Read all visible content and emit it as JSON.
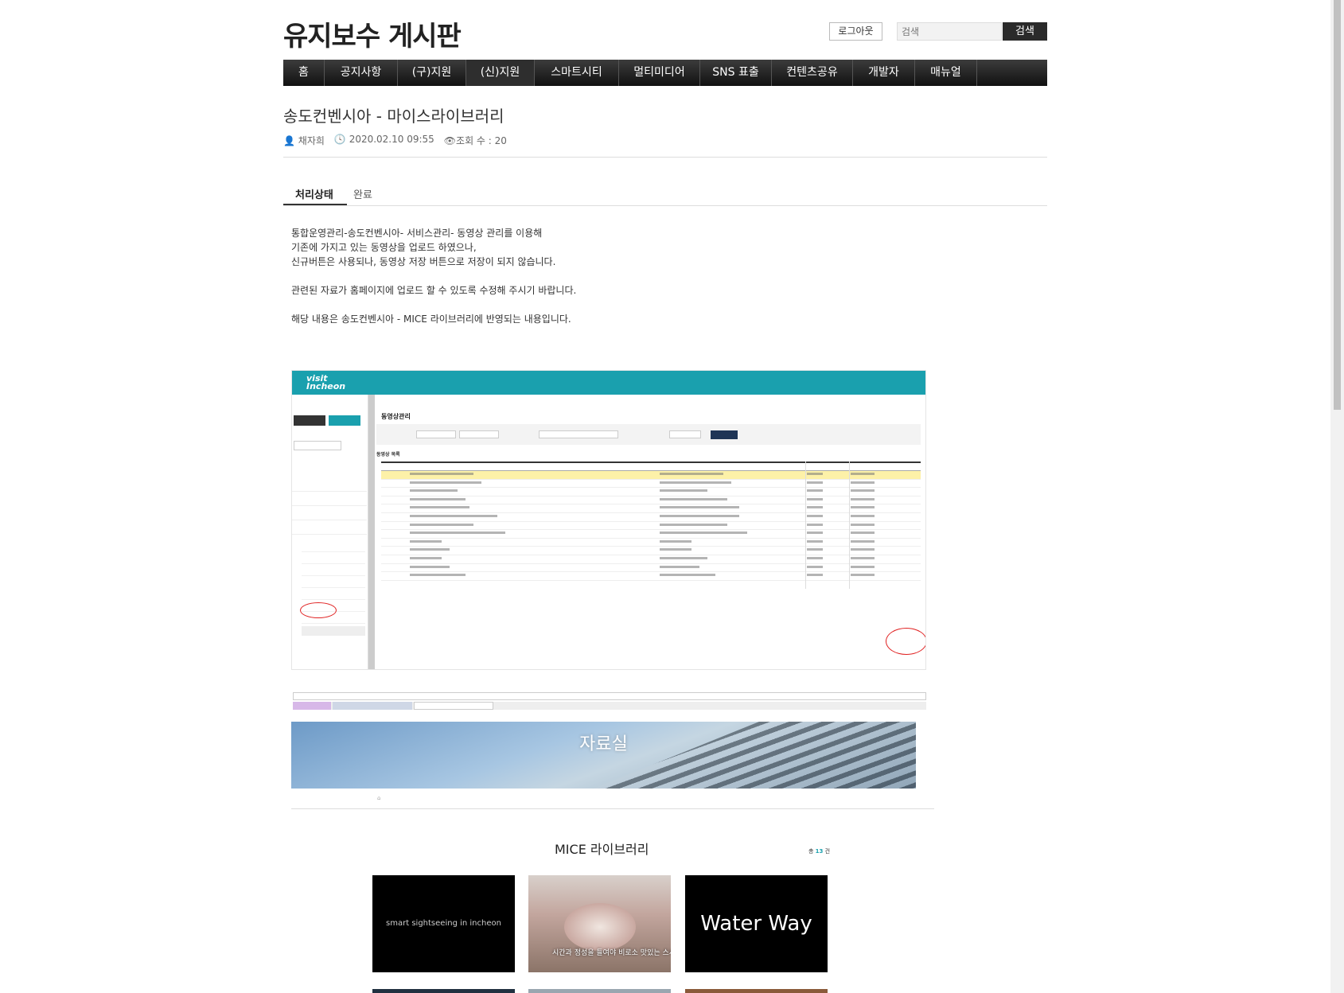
{
  "header": {
    "site_title": "유지보수 게시판",
    "logout_label": "로그아웃",
    "search_placeholder": "검색",
    "search_button": "검색"
  },
  "nav": {
    "items": [
      "홈",
      "공지사항",
      "(구)지원",
      "(신)지원",
      "스마트시티",
      "멀티미디어",
      "SNS 표출",
      "컨텐츠공유",
      "개발자",
      "매뉴얼"
    ]
  },
  "post": {
    "title": "송도컨벤시아 - 마이스라이브러리",
    "author": "채자희",
    "datetime": "2020.02.10 09:55",
    "views": "조회 수 : 20",
    "status_label": "처리상태",
    "status_value": "완료",
    "body_lines": [
      "통합운영관리-송도컨벤시아- 서비스관리- 동영상 관리를 이용해",
      "기존에 가지고 있는 동영상을 업로드 하였으나,",
      "신규버튼은 사용되나, 동영상 저장 버튼으로 저장이 되지 않습니다.",
      "",
      "관련된 자료가 홈페이지에 업로드 할 수 있도록 수정해 주시기 바랍니다.",
      "",
      "해당 내용은 송도컨벤시아 - MICE 라이브러리에 반영되는 내용입니다."
    ]
  },
  "screenshot1": {
    "logo": "visit Incheon",
    "heading": "동영상관리",
    "list_label": "동영상 목록"
  },
  "screenshot2": {
    "hero_title": "자료실"
  },
  "library": {
    "title": "MICE 라이브러리",
    "count_prefix": "총 ",
    "count": "13",
    "count_suffix": " 건",
    "items": [
      {
        "caption": "smart sightseeing in incheon"
      },
      {
        "caption": "시간과 정성을 들여야 비로소 맛있는 스시"
      },
      {
        "caption": "Water Way"
      }
    ]
  },
  "colors": {
    "nav_bg": "#1e1e1e",
    "teal": "#1aa0ae",
    "highlight": "#fdf1a8",
    "annotation_red": "#e02020"
  }
}
